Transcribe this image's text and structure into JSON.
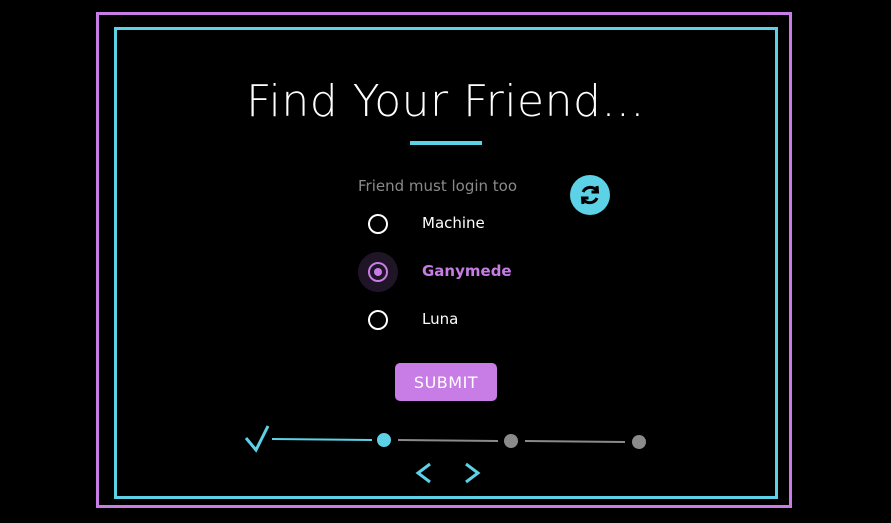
{
  "dialog": {
    "title": "Find Your Friend...",
    "hint": "Friend must login too",
    "refresh_icon": "refresh-icon"
  },
  "options": [
    {
      "label": "Machine",
      "selected": false
    },
    {
      "label": "Ganymede",
      "selected": true
    },
    {
      "label": "Luna",
      "selected": false
    }
  ],
  "submit": {
    "label": "SUBMIT"
  },
  "stepper": {
    "steps": [
      "completed",
      "current",
      "pending",
      "pending"
    ]
  },
  "navigation": {
    "prev_icon": "chevron-left-icon",
    "next_icon": "chevron-right-icon"
  },
  "colors": {
    "accent_purple": "#c77ce6",
    "accent_cyan": "#5dd1e6",
    "background": "#000000",
    "pending_gray": "#8a8a8a"
  }
}
